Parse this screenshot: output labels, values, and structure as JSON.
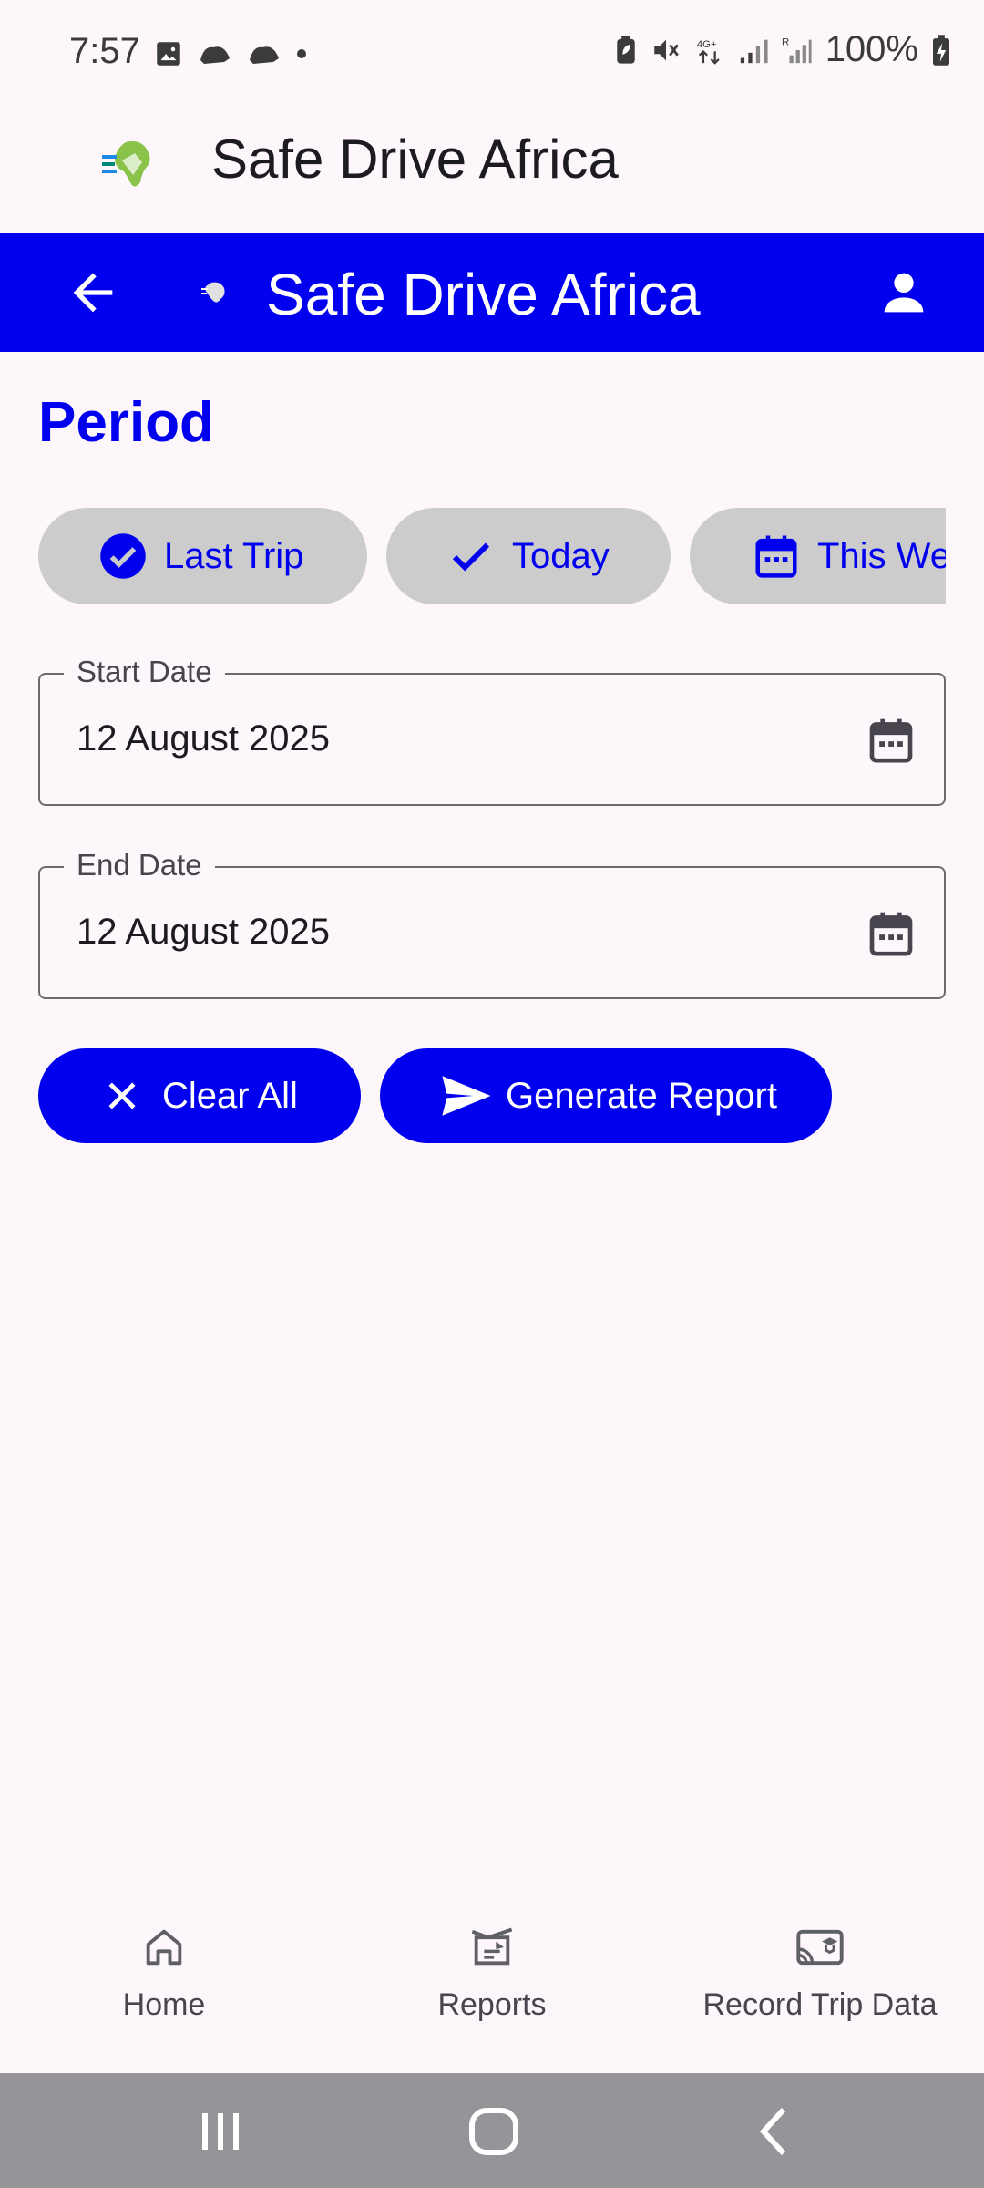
{
  "status_bar": {
    "time": "7:57",
    "battery": "100%"
  },
  "app_header": {
    "title": "Safe Drive Africa"
  },
  "top_bar": {
    "title": "Safe Drive Africa",
    "color": "#0000ee"
  },
  "period": {
    "title": "Period",
    "chips": [
      {
        "label": "Last Trip",
        "icon": "check-circle-icon",
        "selected": true
      },
      {
        "label": "Today",
        "icon": "check-icon",
        "selected": true
      },
      {
        "label": "This Week",
        "icon": "calendar-icon",
        "selected": false
      }
    ]
  },
  "start_date": {
    "label": "Start Date",
    "value": "12 August 2025"
  },
  "end_date": {
    "label": "End Date",
    "value": "12 August 2025"
  },
  "actions": {
    "clear_label": "Clear All",
    "generate_label": "Generate Report"
  },
  "bottom_nav": {
    "items": [
      {
        "label": "Home",
        "icon": "home-icon"
      },
      {
        "label": "Reports",
        "icon": "reports-icon"
      },
      {
        "label": "Record Trip Data",
        "icon": "record-trip-icon"
      }
    ]
  }
}
